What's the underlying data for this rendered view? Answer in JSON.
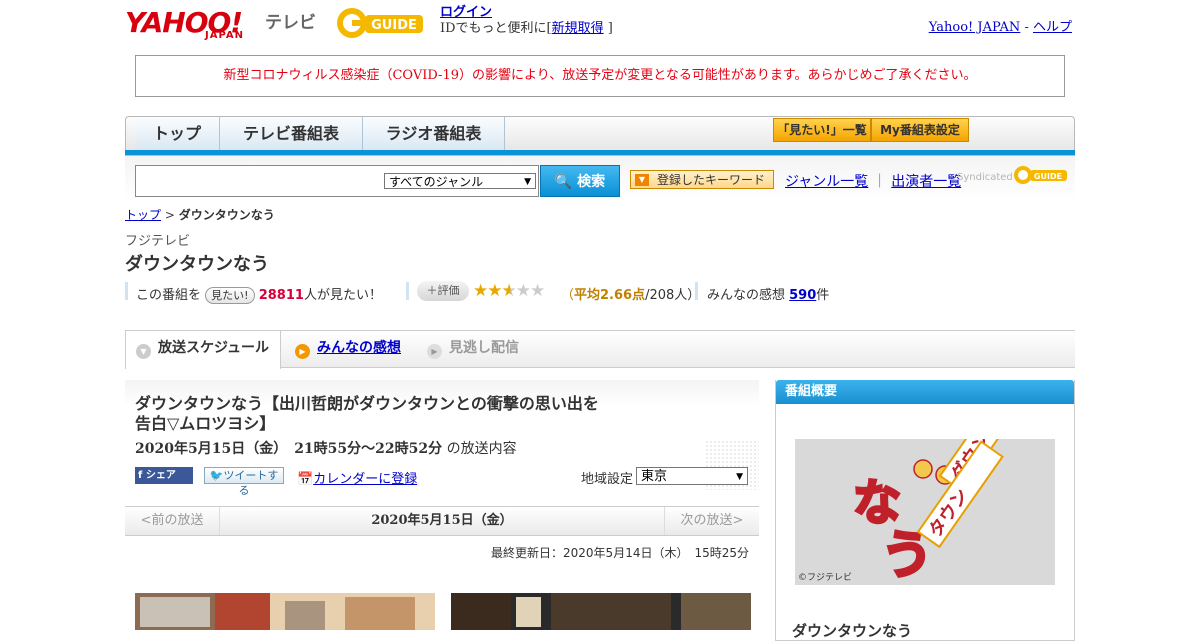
{
  "header": {
    "yahoo_logo": "YAHOO!",
    "yahoo_japan": "JAPAN",
    "tv_label": "テレビ",
    "gguide_logo": "G-GUIDE",
    "login_link": "ログイン",
    "login_sub_prefix": "IDでもっと便利に[",
    "signup_link": "新規取得",
    "login_sub_suffix": "]",
    "yahoo_japan_link": "Yahoo! JAPAN",
    "separator": " - ",
    "help_link": "ヘルプ"
  },
  "notice": "新型コロナウィルス感染症（COVID-19）の影響により、放送予定が変更となる可能性があります。あらかじめご了承ください。",
  "nav": {
    "tabs": [
      "トップ",
      "テレビ番組表",
      "ラジオ番組表"
    ],
    "mitai_list": "「見たい!」一覧",
    "my_schedule": "My番組表設定"
  },
  "search": {
    "genre_selected": "すべてのジャンル",
    "button_label": "検索",
    "keyword_button": "登録したキーワード",
    "genre_list_link": "ジャンル一覧",
    "links_sep": "｜",
    "performer_list_link": "出演者一覧",
    "syndicated": "Syndicated"
  },
  "breadcrumb": {
    "top": "トップ",
    "sep": " > ",
    "current": "ダウンタウンなう"
  },
  "program": {
    "station": "フジテレビ",
    "title": "ダウンタウンなう",
    "mitai_prefix": "この番組を",
    "mitai_badge": "見たい!",
    "mitai_count": "28811",
    "mitai_suffix": "人が見たい！",
    "rating_label": "評価",
    "rating_stars": 2.66,
    "rating_open": "（",
    "rating_avg": "平均2.66点",
    "rating_count": "/208人）",
    "impressions_prefix": "みんなの感想 ",
    "impressions_count": "590",
    "impressions_suffix": "件"
  },
  "subtabs": [
    "放送スケジュール",
    "みんなの感想",
    "見逃し配信"
  ],
  "episode": {
    "title": "ダウンタウンなう【出川哲朗がダウンタウンとの衝撃の思い出を告白▽ムロツヨシ】",
    "datetime": "2020年5月15日（金）　21時55分～22時52分",
    "datetime_suffix": "の放送内容",
    "share_fb": "シェア",
    "tweet": "ツイートする",
    "calendar": "カレンダーに登録",
    "region_label": "地域設定",
    "region_value": "東京"
  },
  "pager": {
    "prev": "<前の放送",
    "current": "2020年5月15日（金）",
    "next": "次の放送>"
  },
  "updated": "最終更新日：2020年5月14日（木）　15時25分",
  "sidebar": {
    "heading": "番組概要",
    "image_copyright": "©フジテレビ",
    "program_name": "ダウンタウンなう"
  },
  "colors": {
    "accent_blue": "#0a93d7",
    "notice_red": "#e60012",
    "yahoo_red": "#d7000f",
    "button_orange": "#f5a400"
  }
}
